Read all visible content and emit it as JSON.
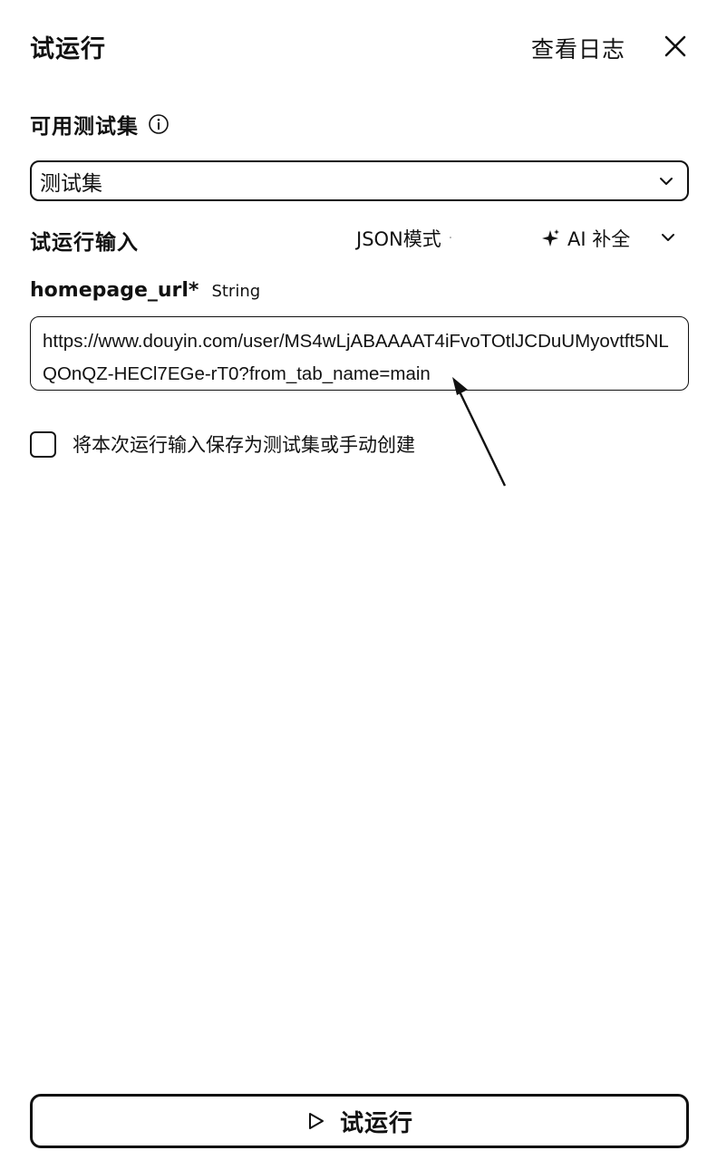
{
  "header": {
    "title": "试运行",
    "view_log": "查看日志",
    "close_icon": "close-icon"
  },
  "testset": {
    "label": "可用测试集",
    "info_icon": "info-icon",
    "selected": "测试集",
    "dropdown_icon": "chevron-down-icon"
  },
  "run_input": {
    "title": "试运行输入",
    "json_mode": "JSON模式",
    "ai_complete": "AI 补全",
    "ai_icon": "sparkle-icon",
    "ai_chevron_icon": "chevron-down-icon"
  },
  "field": {
    "name": "homepage_url*",
    "type": "String",
    "value": "https://www.douyin.com/user/MS4wLjABAAAAT4iFvoTOtlJCDuUMyovtft5NLQOnQZ-HECl7EGe-rT0?from_tab_name=main"
  },
  "save_option": {
    "label": "将本次运行输入保存为测试集或手动创建",
    "checked": false
  },
  "footer": {
    "run_label": "试运行",
    "run_icon": "play-icon"
  }
}
